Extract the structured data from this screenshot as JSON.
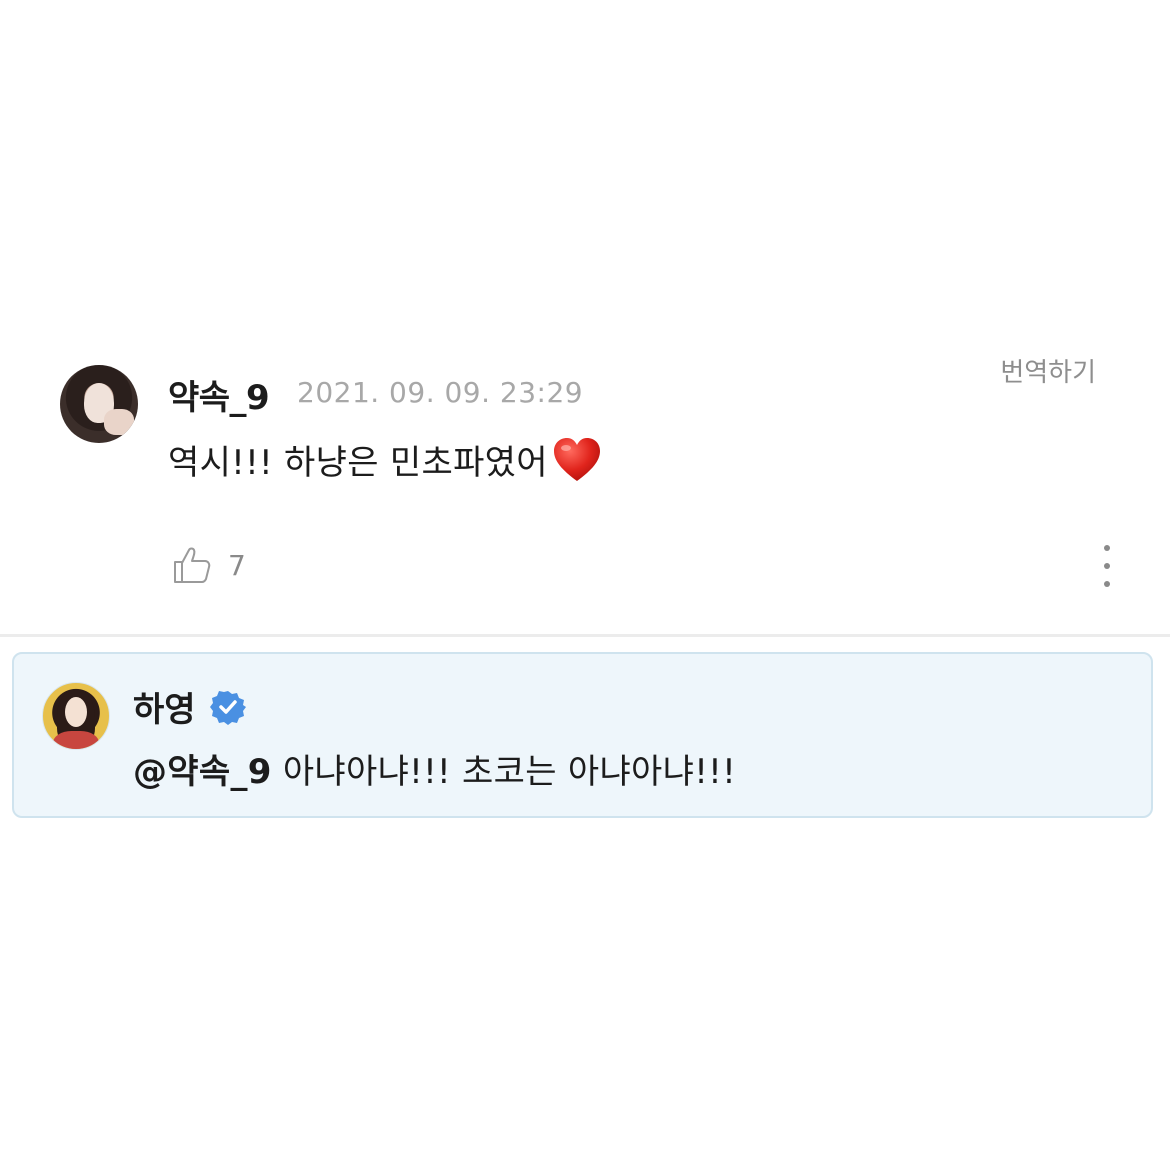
{
  "comment": {
    "username": "약속_9",
    "timestamp": "2021. 09. 09. 23:29",
    "translate_label": "번역하기",
    "text": "역시!!! 하냥은 민초파였어",
    "emoji": "heart",
    "like_count": "7",
    "icons": {
      "like": "thumbs-up-icon",
      "more": "more-vertical-icon",
      "avatar": "user-avatar"
    }
  },
  "reply": {
    "username": "하영",
    "verified": true,
    "mention": "@약속_9",
    "text": " 아냐아냐!!! 초코는 아냐아냐!!!",
    "icons": {
      "verified": "verified-badge-icon",
      "avatar": "artist-avatar"
    }
  },
  "colors": {
    "reply_background": "#eef6fb",
    "reply_border": "#cfe3ee",
    "verified_badge": "#4a90e2",
    "heart": "#e0241c",
    "muted_text": "#a8a8a8"
  }
}
